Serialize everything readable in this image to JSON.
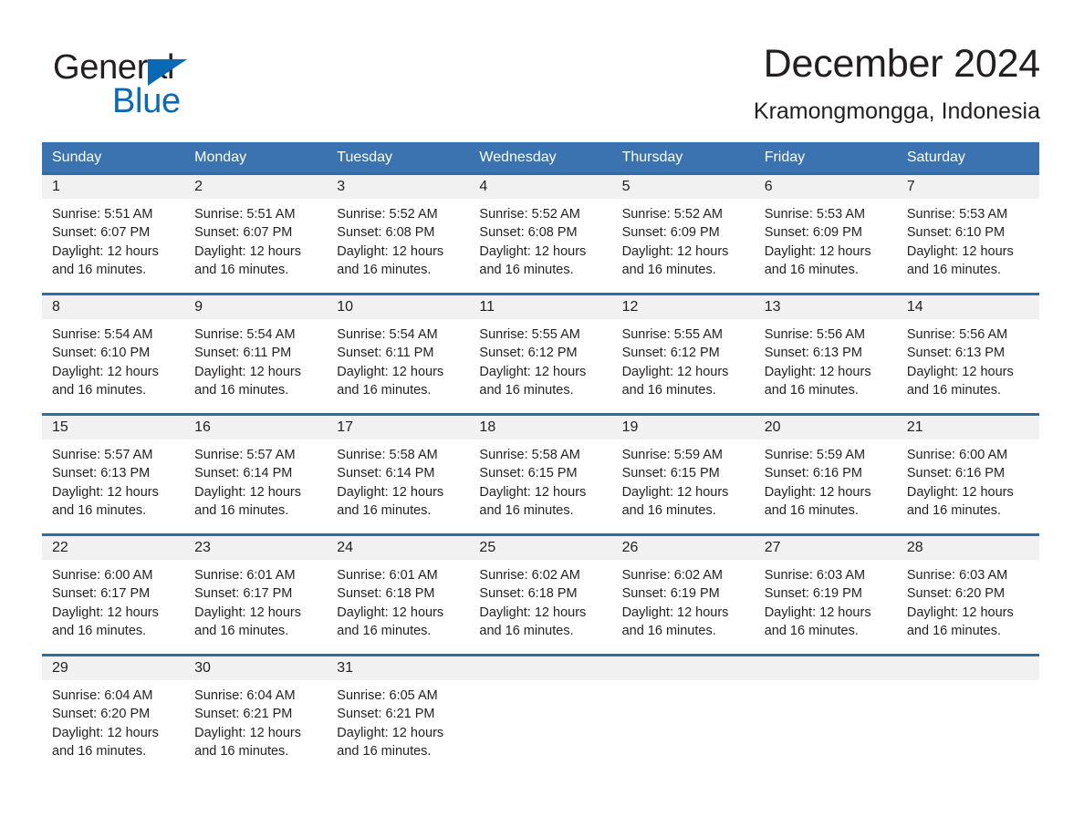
{
  "brand": {
    "word_one": "General",
    "word_two": "Blue",
    "triangle_icon": "brand-triangle-icon",
    "colors": {
      "black": "#231f20",
      "blue": "#0b69b4"
    }
  },
  "header": {
    "title": "December 2024",
    "location": "Kramongmongga, Indonesia"
  },
  "theme": {
    "header_blue": "#3a73b0",
    "row_divider_blue": "#2e6ca8",
    "day_band_gray": "#f1f1f1",
    "text": "#231f20"
  },
  "calendar": {
    "weekdays": [
      "Sunday",
      "Monday",
      "Tuesday",
      "Wednesday",
      "Thursday",
      "Friday",
      "Saturday"
    ],
    "weeks": [
      [
        {
          "day": "1",
          "sunrise": "Sunrise: 5:51 AM",
          "sunset": "Sunset: 6:07 PM",
          "daylight": "Daylight: 12 hours and 16 minutes."
        },
        {
          "day": "2",
          "sunrise": "Sunrise: 5:51 AM",
          "sunset": "Sunset: 6:07 PM",
          "daylight": "Daylight: 12 hours and 16 minutes."
        },
        {
          "day": "3",
          "sunrise": "Sunrise: 5:52 AM",
          "sunset": "Sunset: 6:08 PM",
          "daylight": "Daylight: 12 hours and 16 minutes."
        },
        {
          "day": "4",
          "sunrise": "Sunrise: 5:52 AM",
          "sunset": "Sunset: 6:08 PM",
          "daylight": "Daylight: 12 hours and 16 minutes."
        },
        {
          "day": "5",
          "sunrise": "Sunrise: 5:52 AM",
          "sunset": "Sunset: 6:09 PM",
          "daylight": "Daylight: 12 hours and 16 minutes."
        },
        {
          "day": "6",
          "sunrise": "Sunrise: 5:53 AM",
          "sunset": "Sunset: 6:09 PM",
          "daylight": "Daylight: 12 hours and 16 minutes."
        },
        {
          "day": "7",
          "sunrise": "Sunrise: 5:53 AM",
          "sunset": "Sunset: 6:10 PM",
          "daylight": "Daylight: 12 hours and 16 minutes."
        }
      ],
      [
        {
          "day": "8",
          "sunrise": "Sunrise: 5:54 AM",
          "sunset": "Sunset: 6:10 PM",
          "daylight": "Daylight: 12 hours and 16 minutes."
        },
        {
          "day": "9",
          "sunrise": "Sunrise: 5:54 AM",
          "sunset": "Sunset: 6:11 PM",
          "daylight": "Daylight: 12 hours and 16 minutes."
        },
        {
          "day": "10",
          "sunrise": "Sunrise: 5:54 AM",
          "sunset": "Sunset: 6:11 PM",
          "daylight": "Daylight: 12 hours and 16 minutes."
        },
        {
          "day": "11",
          "sunrise": "Sunrise: 5:55 AM",
          "sunset": "Sunset: 6:12 PM",
          "daylight": "Daylight: 12 hours and 16 minutes."
        },
        {
          "day": "12",
          "sunrise": "Sunrise: 5:55 AM",
          "sunset": "Sunset: 6:12 PM",
          "daylight": "Daylight: 12 hours and 16 minutes."
        },
        {
          "day": "13",
          "sunrise": "Sunrise: 5:56 AM",
          "sunset": "Sunset: 6:13 PM",
          "daylight": "Daylight: 12 hours and 16 minutes."
        },
        {
          "day": "14",
          "sunrise": "Sunrise: 5:56 AM",
          "sunset": "Sunset: 6:13 PM",
          "daylight": "Daylight: 12 hours and 16 minutes."
        }
      ],
      [
        {
          "day": "15",
          "sunrise": "Sunrise: 5:57 AM",
          "sunset": "Sunset: 6:13 PM",
          "daylight": "Daylight: 12 hours and 16 minutes."
        },
        {
          "day": "16",
          "sunrise": "Sunrise: 5:57 AM",
          "sunset": "Sunset: 6:14 PM",
          "daylight": "Daylight: 12 hours and 16 minutes."
        },
        {
          "day": "17",
          "sunrise": "Sunrise: 5:58 AM",
          "sunset": "Sunset: 6:14 PM",
          "daylight": "Daylight: 12 hours and 16 minutes."
        },
        {
          "day": "18",
          "sunrise": "Sunrise: 5:58 AM",
          "sunset": "Sunset: 6:15 PM",
          "daylight": "Daylight: 12 hours and 16 minutes."
        },
        {
          "day": "19",
          "sunrise": "Sunrise: 5:59 AM",
          "sunset": "Sunset: 6:15 PM",
          "daylight": "Daylight: 12 hours and 16 minutes."
        },
        {
          "day": "20",
          "sunrise": "Sunrise: 5:59 AM",
          "sunset": "Sunset: 6:16 PM",
          "daylight": "Daylight: 12 hours and 16 minutes."
        },
        {
          "day": "21",
          "sunrise": "Sunrise: 6:00 AM",
          "sunset": "Sunset: 6:16 PM",
          "daylight": "Daylight: 12 hours and 16 minutes."
        }
      ],
      [
        {
          "day": "22",
          "sunrise": "Sunrise: 6:00 AM",
          "sunset": "Sunset: 6:17 PM",
          "daylight": "Daylight: 12 hours and 16 minutes."
        },
        {
          "day": "23",
          "sunrise": "Sunrise: 6:01 AM",
          "sunset": "Sunset: 6:17 PM",
          "daylight": "Daylight: 12 hours and 16 minutes."
        },
        {
          "day": "24",
          "sunrise": "Sunrise: 6:01 AM",
          "sunset": "Sunset: 6:18 PM",
          "daylight": "Daylight: 12 hours and 16 minutes."
        },
        {
          "day": "25",
          "sunrise": "Sunrise: 6:02 AM",
          "sunset": "Sunset: 6:18 PM",
          "daylight": "Daylight: 12 hours and 16 minutes."
        },
        {
          "day": "26",
          "sunrise": "Sunrise: 6:02 AM",
          "sunset": "Sunset: 6:19 PM",
          "daylight": "Daylight: 12 hours and 16 minutes."
        },
        {
          "day": "27",
          "sunrise": "Sunrise: 6:03 AM",
          "sunset": "Sunset: 6:19 PM",
          "daylight": "Daylight: 12 hours and 16 minutes."
        },
        {
          "day": "28",
          "sunrise": "Sunrise: 6:03 AM",
          "sunset": "Sunset: 6:20 PM",
          "daylight": "Daylight: 12 hours and 16 minutes."
        }
      ],
      [
        {
          "day": "29",
          "sunrise": "Sunrise: 6:04 AM",
          "sunset": "Sunset: 6:20 PM",
          "daylight": "Daylight: 12 hours and 16 minutes."
        },
        {
          "day": "30",
          "sunrise": "Sunrise: 6:04 AM",
          "sunset": "Sunset: 6:21 PM",
          "daylight": "Daylight: 12 hours and 16 minutes."
        },
        {
          "day": "31",
          "sunrise": "Sunrise: 6:05 AM",
          "sunset": "Sunset: 6:21 PM",
          "daylight": "Daylight: 12 hours and 16 minutes."
        },
        {
          "day": "",
          "sunrise": "",
          "sunset": "",
          "daylight": ""
        },
        {
          "day": "",
          "sunrise": "",
          "sunset": "",
          "daylight": ""
        },
        {
          "day": "",
          "sunrise": "",
          "sunset": "",
          "daylight": ""
        },
        {
          "day": "",
          "sunrise": "",
          "sunset": "",
          "daylight": ""
        }
      ]
    ]
  }
}
